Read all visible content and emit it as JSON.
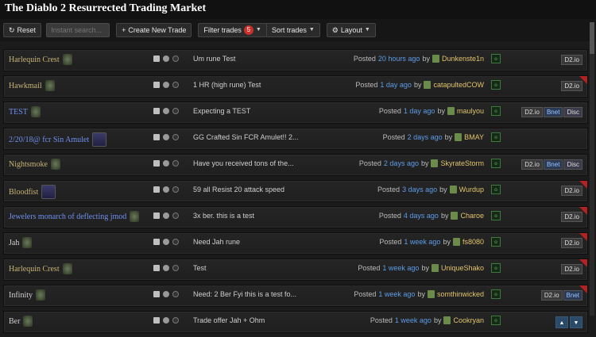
{
  "app": {
    "title": "The Diablo 2 Resurrected Trading Market"
  },
  "toolbar": {
    "reset": "Reset",
    "search_placeholder": "Instant search...",
    "create": "Create New Trade",
    "filter": "Filter trades",
    "filter_count": "5",
    "sort": "Sort trades",
    "layout": "Layout"
  },
  "trades": [
    {
      "name": "Harlequin Crest",
      "quality": "unique",
      "desc": "Um rune Test",
      "posted": "Posted",
      "ago": "20 hours ago",
      "by": "by",
      "user": "Dunkenste1n",
      "tags": [
        "D2.io"
      ],
      "ribbon": false
    },
    {
      "name": "Hawkmail",
      "quality": "unique",
      "desc": "1 HR (high rune) Test",
      "posted": "Posted",
      "ago": "1 day ago",
      "by": "by",
      "user": "catapultedCOW",
      "tags": [
        "D2.io"
      ],
      "ribbon": true
    },
    {
      "name": "TEST",
      "quality": "magic",
      "desc": "Expecting a TEST",
      "posted": "Posted",
      "ago": "1 day ago",
      "by": "by",
      "user": "maulyou",
      "tags": [
        "D2.io",
        "Bnet",
        "Disc"
      ],
      "ribbon": false
    },
    {
      "name": "2/20/18@ fcr Sin Amulet",
      "quality": "magic",
      "desc": "GG Crafted Sin FCR Amulet!! 2...",
      "posted": "Posted",
      "ago": "2 days ago",
      "by": "by",
      "user": "BMAY",
      "tags": [],
      "ribbon": false
    },
    {
      "name": "Nightsmoke",
      "quality": "unique",
      "desc": "Have you received tons of the...",
      "posted": "Posted",
      "ago": "2 days ago",
      "by": "by",
      "user": "SkyrateStorm",
      "tags": [
        "D2.io",
        "Bnet",
        "Disc"
      ],
      "ribbon": false
    },
    {
      "name": "Bloodfist",
      "quality": "unique",
      "desc": "59 all Resist 20 attack speed",
      "posted": "Posted",
      "ago": "3 days ago",
      "by": "by",
      "user": "Wurdup",
      "tags": [
        "D2.io"
      ],
      "ribbon": true
    },
    {
      "name": "Jewelers monarch of deflecting jmod",
      "quality": "magic",
      "desc": "3x ber. this is a test",
      "posted": "Posted",
      "ago": "4 days ago",
      "by": "by",
      "user": "Charoe",
      "tags": [
        "D2.io"
      ],
      "ribbon": true
    },
    {
      "name": "Jah",
      "quality": "base",
      "desc": "Need Jah rune",
      "posted": "Posted",
      "ago": "1 week ago",
      "by": "by",
      "user": "fs8080",
      "tags": [
        "D2.io"
      ],
      "ribbon": true
    },
    {
      "name": "Harlequin Crest",
      "quality": "unique",
      "desc": "Test",
      "posted": "Posted",
      "ago": "1 week ago",
      "by": "by",
      "user": "UniqueShako",
      "tags": [
        "D2.io"
      ],
      "ribbon": true
    },
    {
      "name": "Infinity",
      "quality": "base",
      "desc": "Need: 2 Ber Fyi this is a test fo...",
      "posted": "Posted",
      "ago": "1 week ago",
      "by": "by",
      "user": "somthinwicked",
      "tags": [
        "D2.io",
        "Bnet"
      ],
      "ribbon": true
    },
    {
      "name": "Ber",
      "quality": "base",
      "desc": "Trade offer Jah + Ohm",
      "posted": "Posted",
      "ago": "1 week ago",
      "by": "by",
      "user": "Cookryan",
      "tags": [],
      "ribbon": false
    }
  ],
  "colors": {
    "unique": "#c7b377",
    "magic": "#6f8fef",
    "accent": "#5d9ce6",
    "user": "#e2c46a"
  }
}
